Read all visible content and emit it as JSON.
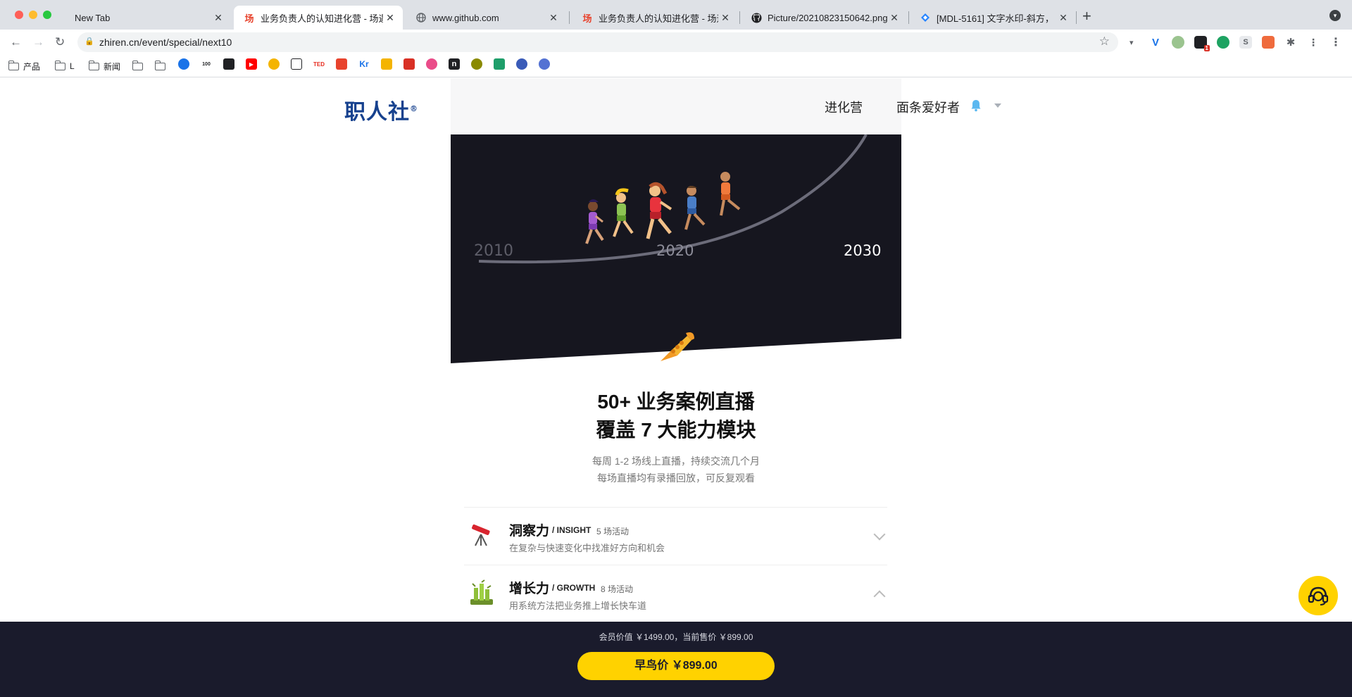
{
  "browser": {
    "tabs": [
      {
        "title": "New Tab",
        "favicon": "none"
      },
      {
        "title": "业务负责人的认知进化营 - 场遇",
        "favicon": "chang-logo",
        "active": true
      },
      {
        "title": "www.github.com",
        "favicon": "globe-icon"
      },
      {
        "title": "业务负责人的认知进化营 - 场遇",
        "favicon": "chang-logo"
      },
      {
        "title": "Picture/20210823150642.png",
        "favicon": "github-icon"
      },
      {
        "title": "[MDL-5161] 文字水印-斜方，",
        "favicon": "jira-icon"
      }
    ],
    "url": "zhiren.cn/event/special/next10",
    "bookmarks": [
      "产品",
      "L",
      "新闻"
    ],
    "favicon_glyph": "场",
    "bookmark_badges": [
      "100",
      "TED",
      "Kr",
      "n"
    ],
    "extension_labels": [
      "1",
      "S"
    ]
  },
  "header": {
    "logo": "职人社",
    "logo_mark": "®",
    "nav": [
      "进化营",
      "面条爱好者"
    ]
  },
  "hero": {
    "years": [
      "2010",
      "2020",
      "2030"
    ]
  },
  "intro": {
    "headline_line1": "50+ 业务案例直播",
    "headline_line2": "覆盖 7 大能力模块",
    "sub_line1": "每周 1-2 场线上直播，持续交流几个月",
    "sub_line2": "每场直播均有录播回放，可反复观看"
  },
  "modules": [
    {
      "name": "洞察力",
      "en": "/ INSIGHT",
      "count": "5 场活动",
      "desc": "在复杂与快速变化中找准好方向和机会",
      "icon": "telescope-icon",
      "expanded": false
    },
    {
      "name": "增长力",
      "en": "/ GROWTH",
      "count": "8 场活动",
      "desc": "用系统方法把业务推上增长快车道",
      "icon": "bamboo-icon",
      "expanded": true
    }
  ],
  "purchase": {
    "price_info": "会员价值 ￥1499.00，当前售价 ￥899.00",
    "button": "早鸟价 ￥899.00"
  },
  "colors": {
    "accent": "#ffd200",
    "dark_bar": "#1a1b2c",
    "logo": "#16418e"
  }
}
